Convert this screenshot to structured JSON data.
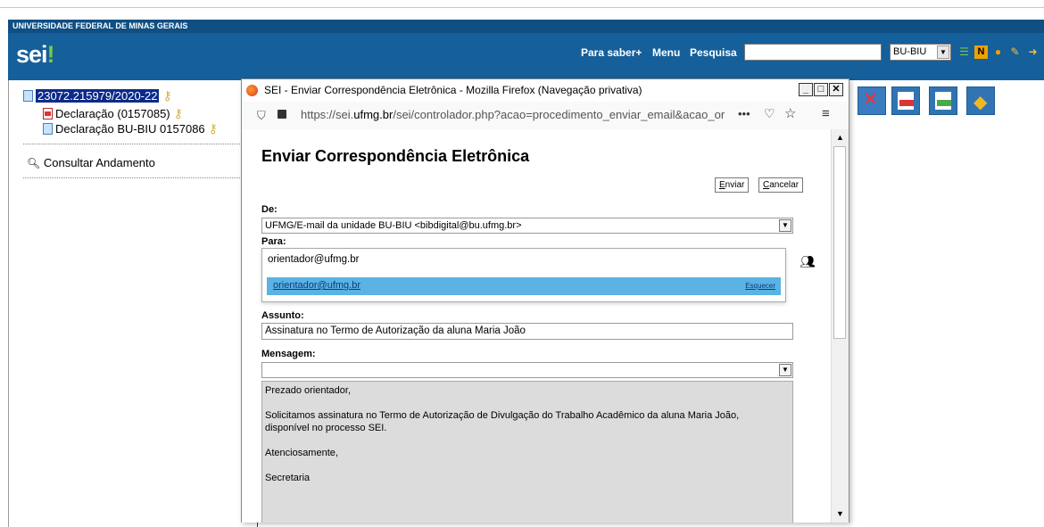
{
  "header": {
    "university": "UNIVERSIDADE FEDERAL DE MINAS GERAIS",
    "logo": "sei",
    "logo_mark": "!",
    "links": [
      "Para saber+",
      "Menu",
      "Pesquisa"
    ],
    "unit_select": "BU-BIU",
    "icons": [
      "list-icon",
      "notes-icon",
      "user-icon",
      "tools-icon",
      "exit-icon"
    ]
  },
  "tree": {
    "process": "23072.215979/2020-22",
    "docs": [
      "Declaração (0157085)",
      "Declaração BU-BIU 0157086"
    ],
    "consult": "Consultar Andamento"
  },
  "right_icons": [
    "disconnect-icon",
    "pdf-icon",
    "zip-icon",
    "tag-icon"
  ],
  "popup": {
    "title": "SEI - Enviar Correspondência Eletrônica - Mozilla Firefox (Navegação privativa)",
    "url_prefix": "https://sei.",
    "url_domain": "ufmg.br",
    "url_suffix": "/sei/controlador.php?acao=procedimento_enviar_email&acao_or",
    "url_more": "•••",
    "heading": "Enviar Correspondência Eletrônica",
    "buttons": {
      "send": "Enviar",
      "send_key": "E",
      "cancel": "Cancelar",
      "cancel_key": "C"
    },
    "labels": {
      "from": "De:",
      "to": "Para:",
      "subject": "Assunto:",
      "message": "Mensagem:"
    },
    "from_value": "UFMG/E-mail da unidade BU-BIU <bibdigital@bu.ufmg.br>",
    "to_value": "orientador@ufmg.br",
    "suggestion": "orientador@ufmg.br",
    "suggestion_forget": "Esquecer",
    "subject_value": "Assinatura no Termo de Autorização da aluna Maria João",
    "message_select": "",
    "message_lines": [
      "Prezado orientador,",
      "",
      "Solicitamos assinatura no Termo de Autorização de Divulgação do Trabalho Acadêmico da aluna Maria João,",
      "disponível no processo SEI.",
      "",
      "Atenciosamente,",
      "",
      "Secretaria"
    ]
  },
  "colors": {
    "header": "#155f9a",
    "highlight": "#5ab3e3",
    "process_bg": "#0c2a8a"
  }
}
